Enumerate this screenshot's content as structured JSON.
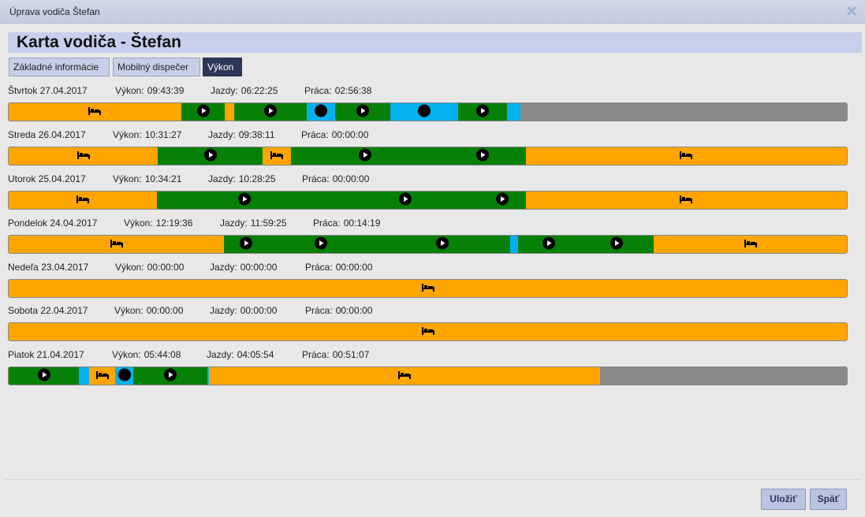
{
  "window": {
    "title": "Úprava vodiča Štefan"
  },
  "header": {
    "title": "Karta vodiča - Štefan"
  },
  "tabs": [
    {
      "label": "Základné informácie",
      "active": false
    },
    {
      "label": "Mobilný dispečer",
      "active": false
    },
    {
      "label": "Výkon",
      "active": true
    }
  ],
  "labels": {
    "vykon": "Výkon:",
    "jazdy": "Jazdy:",
    "praca": "Práca:"
  },
  "legend_colors": {
    "rest": "#ffa500",
    "drive": "#078007",
    "work": "#05b0ef",
    "no_data": "#8a8a8a"
  },
  "days": [
    {
      "date": "Štvrtok 27.04.2017",
      "vykon": "09:43:39",
      "jazdy": "06:22:25",
      "praca": "02:56:38",
      "timeline": [
        [
          "rest",
          0,
          20.6
        ],
        [
          "drive",
          20.6,
          25.8
        ],
        [
          "rest",
          25.8,
          26.9
        ],
        [
          "drive",
          26.9,
          35.6
        ],
        [
          "work",
          35.6,
          38.9
        ],
        [
          "drive",
          38.9,
          45.5
        ],
        [
          "work",
          45.5,
          53.6
        ],
        [
          "drive",
          53.6,
          59.5
        ],
        [
          "work",
          59.5,
          61.1
        ],
        [
          "none",
          61.1,
          100
        ]
      ]
    },
    {
      "date": "Streda 26.04.2017",
      "vykon": "10:31:27",
      "jazdy": "09:38:11",
      "praca": "00:00:00",
      "timeline": [
        [
          "rest",
          0,
          17.8
        ],
        [
          "drive",
          17.8,
          30.3
        ],
        [
          "rest",
          30.3,
          33.7
        ],
        [
          "drive",
          33.7,
          51.3
        ],
        [
          "drive",
          51.3,
          61.7
        ],
        [
          "rest",
          61.7,
          100
        ]
      ]
    },
    {
      "date": "Utorok 25.04.2017",
      "vykon": "10:34:21",
      "jazdy": "10:28:25",
      "praca": "00:00:00",
      "timeline": [
        [
          "rest",
          0,
          17.7
        ],
        [
          "drive",
          17.7,
          38.6
        ],
        [
          "drive",
          38.6,
          56.1
        ],
        [
          "drive",
          56.1,
          61.7
        ],
        [
          "rest",
          61.7,
          100
        ]
      ]
    },
    {
      "date": "Pondelok 24.04.2017",
      "vykon": "12:19:36",
      "jazdy": "11:59:25",
      "praca": "00:14:19",
      "timeline": [
        [
          "rest",
          0,
          25.7
        ],
        [
          "drive",
          25.7,
          30.9
        ],
        [
          "drive",
          30.9,
          43.7
        ],
        [
          "drive",
          43.7,
          59.8
        ],
        [
          "work",
          59.8,
          60.8
        ],
        [
          "drive",
          60.8,
          68.0
        ],
        [
          "drive",
          68.0,
          77.0
        ],
        [
          "rest",
          77.0,
          100
        ]
      ]
    },
    {
      "date": "Nedeľa 23.04.2017",
      "vykon": "00:00:00",
      "jazdy": "00:00:00",
      "praca": "00:00:00",
      "timeline": [
        [
          "rest",
          0,
          100
        ]
      ]
    },
    {
      "date": "Sobota 22.04.2017",
      "vykon": "00:00:00",
      "jazdy": "00:00:00",
      "praca": "00:00:00",
      "timeline": [
        [
          "rest",
          0,
          100
        ]
      ]
    },
    {
      "date": "Piatok 21.04.2017",
      "vykon": "05:44:08",
      "jazdy": "04:05:54",
      "praca": "00:51:07",
      "timeline": [
        [
          "drive",
          0,
          8.4
        ],
        [
          "work",
          8.4,
          9.6
        ],
        [
          "rest",
          9.6,
          12.7
        ],
        [
          "work",
          12.7,
          14.9
        ],
        [
          "drive",
          14.9,
          23.7
        ],
        [
          "work",
          23.7,
          23.9
        ],
        [
          "rest",
          23.9,
          70.6
        ],
        [
          "none",
          70.6,
          100
        ]
      ]
    }
  ],
  "buttons": {
    "save": "Uložiť",
    "back": "Späť"
  }
}
